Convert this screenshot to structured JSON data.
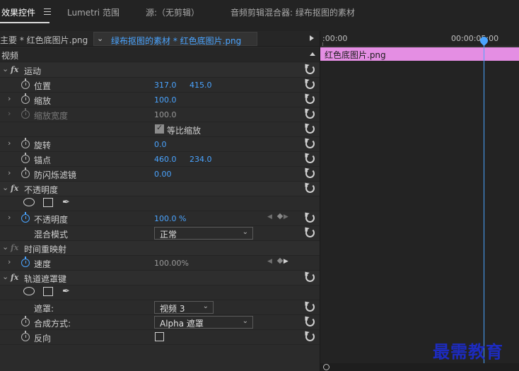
{
  "tabs": {
    "effect_controls": "效果控件",
    "lumetri": "Lumetri 范围",
    "source": "源:（无剪辑）",
    "audio_mixer": "音频剪辑混合器: 绿布抠图的素材"
  },
  "clip_header": {
    "master": "主要 * 红色底图片.png",
    "sequence": "绿布抠图的素材 * 红色底图片.png"
  },
  "video_header": "视频",
  "motion": {
    "name": "运动",
    "position": {
      "label": "位置",
      "x": "317.0",
      "y": "415.0"
    },
    "scale": {
      "label": "缩放",
      "value": "100.0"
    },
    "scale_width": {
      "label": "缩放宽度",
      "value": "100.0"
    },
    "uniform_scale": {
      "label": "等比缩放",
      "checked": true
    },
    "rotation": {
      "label": "旋转",
      "value": "0.0"
    },
    "anchor": {
      "label": "锚点",
      "x": "460.0",
      "y": "234.0"
    },
    "anti_flicker": {
      "label": "防闪烁滤镜",
      "value": "0.00"
    }
  },
  "opacity": {
    "name": "不透明度",
    "value_label": "不透明度",
    "value": "100.0 %",
    "blend_label": "混合模式",
    "blend_value": "正常"
  },
  "time_remap": {
    "name": "时间重映射",
    "speed_label": "速度",
    "speed_value": "100.00%"
  },
  "track_matte": {
    "name": "轨道遮罩键",
    "matte_label": "遮罩:",
    "matte_value": "视频 3",
    "composite_label": "合成方式:",
    "composite_value": "Alpha 遮罩",
    "reverse_label": "反向",
    "reverse_checked": false
  },
  "timeline": {
    "start": ":00:00",
    "playhead": "00:00:05:00",
    "clip": "红色底图片.png",
    "clip_color": "#e48ee3",
    "playhead_color": "#4aa4ff"
  },
  "watermark": "最需教育",
  "fx_glyph": "fx",
  "icons": {
    "expand": "›",
    "collapse": "⌄",
    "dropdown": "⌄",
    "seq_chevron": "⌄",
    "pen": "✒"
  }
}
